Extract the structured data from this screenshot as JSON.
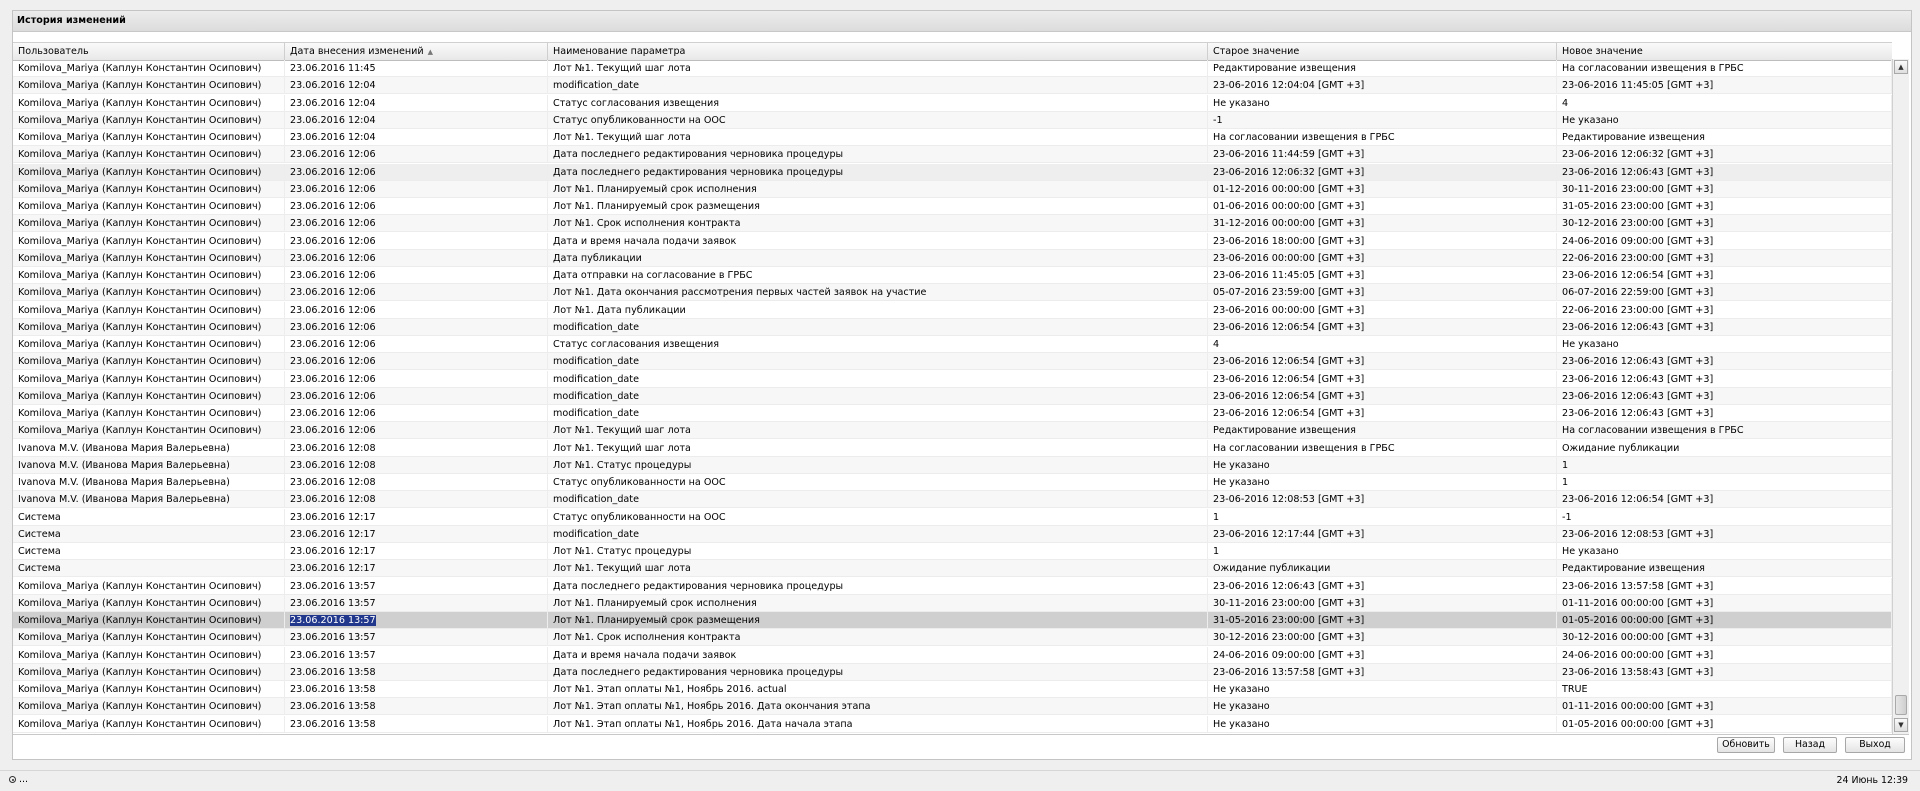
{
  "window": {
    "title": "История изменений"
  },
  "columns": [
    "Пользователь",
    "Дата внесения изменений",
    "Наименование параметра",
    "Старое значение",
    "Новое значение"
  ],
  "sort_indicator": "▲",
  "rows": [
    [
      "Komilova_Mariya (Каплун Константин Осипович)",
      "23.06.2016 11:45",
      "Лот №1. Текущий шаг лота",
      "Редактирование извещения",
      "На согласовании извещения в ГРБС"
    ],
    [
      "Komilova_Mariya (Каплун Константин Осипович)",
      "23.06.2016 12:04",
      "modification_date",
      "23-06-2016 12:04:04 [GMT +3]",
      "23-06-2016 11:45:05 [GMT +3]"
    ],
    [
      "Komilova_Mariya (Каплун Константин Осипович)",
      "23.06.2016 12:04",
      "Статус согласования извещения",
      "Не указано",
      "4"
    ],
    [
      "Komilova_Mariya (Каплун Константин Осипович)",
      "23.06.2016 12:04",
      "Статус опубликованности на ООС",
      "-1",
      "Не указано"
    ],
    [
      "Komilova_Mariya (Каплун Константин Осипович)",
      "23.06.2016 12:04",
      "Лот №1. Текущий шаг лота",
      "На согласовании извещения в ГРБС",
      "Редактирование извещения"
    ],
    [
      "Komilova_Mariya (Каплун Константин Осипович)",
      "23.06.2016 12:06",
      "Дата последнего редактирования черновика процедуры",
      "23-06-2016 11:44:59 [GMT +3]",
      "23-06-2016 12:06:32 [GMT +3]"
    ],
    [
      "Komilova_Mariya (Каплун Константин Осипович)",
      "23.06.2016 12:06",
      "Дата последнего редактирования черновика процедуры",
      "23-06-2016 12:06:32 [GMT +3]",
      "23-06-2016 12:06:43 [GMT +3]"
    ],
    [
      "Komilova_Mariya (Каплун Константин Осипович)",
      "23.06.2016 12:06",
      "Лот №1. Планируемый срок исполнения",
      "01-12-2016 00:00:00 [GMT +3]",
      "30-11-2016 23:00:00 [GMT +3]"
    ],
    [
      "Komilova_Mariya (Каплун Константин Осипович)",
      "23.06.2016 12:06",
      "Лот №1. Планируемый срок размещения",
      "01-06-2016 00:00:00 [GMT +3]",
      "31-05-2016 23:00:00 [GMT +3]"
    ],
    [
      "Komilova_Mariya (Каплун Константин Осипович)",
      "23.06.2016 12:06",
      "Лот №1. Срок исполнения контракта",
      "31-12-2016 00:00:00 [GMT +3]",
      "30-12-2016 23:00:00 [GMT +3]"
    ],
    [
      "Komilova_Mariya (Каплун Константин Осипович)",
      "23.06.2016 12:06",
      "Дата и время начала подачи заявок",
      "23-06-2016 18:00:00 [GMT +3]",
      "24-06-2016 09:00:00 [GMT +3]"
    ],
    [
      "Komilova_Mariya (Каплун Константин Осипович)",
      "23.06.2016 12:06",
      "Дата публикации",
      "23-06-2016 00:00:00 [GMT +3]",
      "22-06-2016 23:00:00 [GMT +3]"
    ],
    [
      "Komilova_Mariya (Каплун Константин Осипович)",
      "23.06.2016 12:06",
      "Дата отправки на согласование в ГРБС",
      "23-06-2016 11:45:05 [GMT +3]",
      "23-06-2016 12:06:54 [GMT +3]"
    ],
    [
      "Komilova_Mariya (Каплун Константин Осипович)",
      "23.06.2016 12:06",
      "Лот №1. Дата окончания рассмотрения первых частей заявок на участие",
      "05-07-2016 23:59:00 [GMT +3]",
      "06-07-2016 22:59:00 [GMT +3]"
    ],
    [
      "Komilova_Mariya (Каплун Константин Осипович)",
      "23.06.2016 12:06",
      "Лот №1. Дата публикации",
      "23-06-2016 00:00:00 [GMT +3]",
      "22-06-2016 23:00:00 [GMT +3]"
    ],
    [
      "Komilova_Mariya (Каплун Константин Осипович)",
      "23.06.2016 12:06",
      "modification_date",
      "23-06-2016 12:06:54 [GMT +3]",
      "23-06-2016 12:06:43 [GMT +3]"
    ],
    [
      "Komilova_Mariya (Каплун Константин Осипович)",
      "23.06.2016 12:06",
      "Статус согласования извещения",
      "4",
      "Не указано"
    ],
    [
      "Komilova_Mariya (Каплун Константин Осипович)",
      "23.06.2016 12:06",
      "modification_date",
      "23-06-2016 12:06:54 [GMT +3]",
      "23-06-2016 12:06:43 [GMT +3]"
    ],
    [
      "Komilova_Mariya (Каплун Константин Осипович)",
      "23.06.2016 12:06",
      "modification_date",
      "23-06-2016 12:06:54 [GMT +3]",
      "23-06-2016 12:06:43 [GMT +3]"
    ],
    [
      "Komilova_Mariya (Каплун Константин Осипович)",
      "23.06.2016 12:06",
      "modification_date",
      "23-06-2016 12:06:54 [GMT +3]",
      "23-06-2016 12:06:43 [GMT +3]"
    ],
    [
      "Komilova_Mariya (Каплун Константин Осипович)",
      "23.06.2016 12:06",
      "modification_date",
      "23-06-2016 12:06:54 [GMT +3]",
      "23-06-2016 12:06:43 [GMT +3]"
    ],
    [
      "Komilova_Mariya (Каплун Константин Осипович)",
      "23.06.2016 12:06",
      "Лот №1. Текущий шаг лота",
      "Редактирование извещения",
      "На согласовании извещения в ГРБС"
    ],
    [
      "Ivanova M.V. (Иванова Мария Валерьевна)",
      "23.06.2016 12:08",
      "Лот №1. Текущий шаг лота",
      "На согласовании извещения в ГРБС",
      "Ожидание публикации"
    ],
    [
      "Ivanova M.V. (Иванова Мария Валерьевна)",
      "23.06.2016 12:08",
      "Лот №1. Статус процедуры",
      "Не указано",
      "1"
    ],
    [
      "Ivanova M.V. (Иванова Мария Валерьевна)",
      "23.06.2016 12:08",
      "Статус опубликованности на ООС",
      "Не указано",
      "1"
    ],
    [
      "Ivanova M.V. (Иванова Мария Валерьевна)",
      "23.06.2016 12:08",
      "modification_date",
      "23-06-2016 12:08:53 [GMT +3]",
      "23-06-2016 12:06:54 [GMT +3]"
    ],
    [
      "Система",
      "23.06.2016 12:17",
      "Статус опубликованности на ООС",
      "1",
      "-1"
    ],
    [
      "Система",
      "23.06.2016 12:17",
      "modification_date",
      "23-06-2016 12:17:44 [GMT +3]",
      "23-06-2016 12:08:53 [GMT +3]"
    ],
    [
      "Система",
      "23.06.2016 12:17",
      "Лот №1. Статус процедуры",
      "1",
      "Не указано"
    ],
    [
      "Система",
      "23.06.2016 12:17",
      "Лот №1. Текущий шаг лота",
      "Ожидание публикации",
      "Редактирование извещения"
    ],
    [
      "Komilova_Mariya (Каплун Константин Осипович)",
      "23.06.2016 13:57",
      "Дата последнего редактирования черновика процедуры",
      "23-06-2016 12:06:43 [GMT +3]",
      "23-06-2016 13:57:58 [GMT +3]"
    ],
    [
      "Komilova_Mariya (Каплун Константин Осипович)",
      "23.06.2016 13:57",
      "Лот №1. Планируемый срок исполнения",
      "30-11-2016 23:00:00 [GMT +3]",
      "01-11-2016 00:00:00 [GMT +3]"
    ],
    [
      "Komilova_Mariya (Каплун Константин Осипович)",
      "23.06.2016 13:57",
      "Лот №1. Планируемый срок размещения",
      "31-05-2016 23:00:00 [GMT +3]",
      "01-05-2016 00:00:00 [GMT +3]"
    ],
    [
      "Komilova_Mariya (Каплун Константин Осипович)",
      "23.06.2016 13:57",
      "Лот №1. Срок исполнения контракта",
      "30-12-2016 23:00:00 [GMT +3]",
      "30-12-2016 00:00:00 [GMT +3]"
    ],
    [
      "Komilova_Mariya (Каплун Константин Осипович)",
      "23.06.2016 13:57",
      "Дата и время начала подачи заявок",
      "24-06-2016 09:00:00 [GMT +3]",
      "24-06-2016 00:00:00 [GMT +3]"
    ],
    [
      "Komilova_Mariya (Каплун Константин Осипович)",
      "23.06.2016 13:58",
      "Дата последнего редактирования черновика процедуры",
      "23-06-2016 13:57:58 [GMT +3]",
      "23-06-2016 13:58:43 [GMT +3]"
    ],
    [
      "Komilova_Mariya (Каплун Константин Осипович)",
      "23.06.2016 13:58",
      "Лот №1. Этап оплаты №1, Ноябрь 2016. actual",
      "Не указано",
      "TRUE"
    ],
    [
      "Komilova_Mariya (Каплун Константин Осипович)",
      "23.06.2016 13:58",
      "Лот №1. Этап оплаты №1, Ноябрь 2016. Дата окончания этапа",
      "Не указано",
      "01-11-2016 00:00:00 [GMT +3]"
    ],
    [
      "Komilova_Mariya (Каплун Константин Осипович)",
      "23.06.2016 13:58",
      "Лот №1. Этап оплаты №1, Ноябрь 2016. Дата начала этапа",
      "Не указано",
      "01-05-2016 00:00:00 [GMT +3]"
    ]
  ],
  "selected_row": 32,
  "hover_row": 6,
  "buttons": {
    "refresh": "Обновить",
    "back": "Назад",
    "exit": "Выход"
  },
  "status": {
    "left": "...",
    "datetime": "24 Июнь 12:39"
  },
  "icons": {
    "scroll_up": "triangle-up",
    "scroll_down": "triangle-down",
    "status_gear": "gear-icon"
  }
}
